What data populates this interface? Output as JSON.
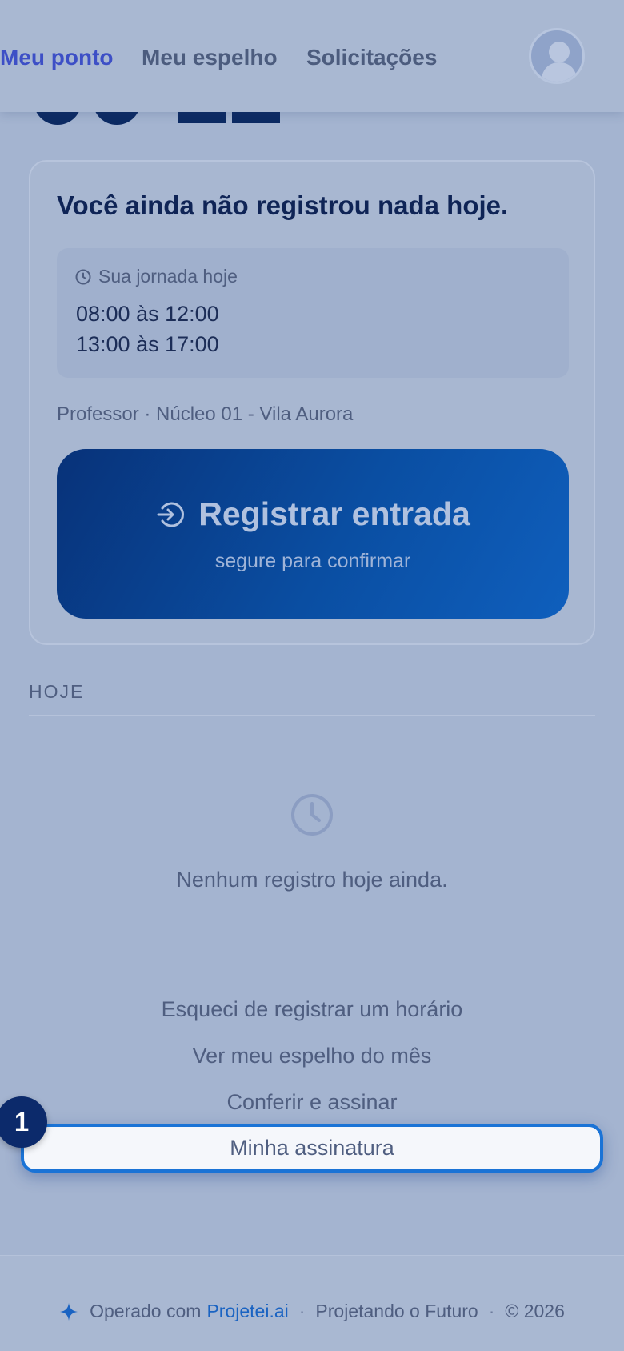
{
  "nav": {
    "items": [
      {
        "label": "Meu ponto",
        "active": true
      },
      {
        "label": "Meu espelho",
        "active": false
      },
      {
        "label": "Solicitações",
        "active": false
      }
    ],
    "avatar_icon": "user-avatar-icon"
  },
  "card": {
    "title": "Você ainda não registrou nada hoje.",
    "schedule": {
      "heading": "Sua jornada hoje",
      "icon": "clock-icon",
      "shifts": [
        "08:00 às 12:00",
        "13:00 às 17:00"
      ]
    },
    "role_location": "Professor · Núcleo 01 - Vila Aurora",
    "register_button": {
      "label": "Registrar entrada",
      "hint": "segure para confirmar",
      "icon": "login-arrow-icon"
    }
  },
  "today": {
    "section_label": "HOJE",
    "empty_icon": "clock-icon",
    "empty_text": "Nenhum registro hoje ainda."
  },
  "links": [
    "Esqueci de registrar um horário",
    "Ver meu espelho do mês",
    "Conferir e assinar",
    "Minha assinatura"
  ],
  "step_badge": "1",
  "footer": {
    "prefix": "Operado com",
    "brand": "Projetei.ai",
    "tagline": "Projetando o Futuro",
    "copyright": "© 2026",
    "brand_color": "#1a63c2",
    "icon": "sparkle-icon"
  },
  "colors": {
    "accent": "#3d4fc6",
    "button_gradient_start": "#083279",
    "button_gradient_end": "#0f5fbd",
    "highlight_border": "#1a73d6"
  }
}
